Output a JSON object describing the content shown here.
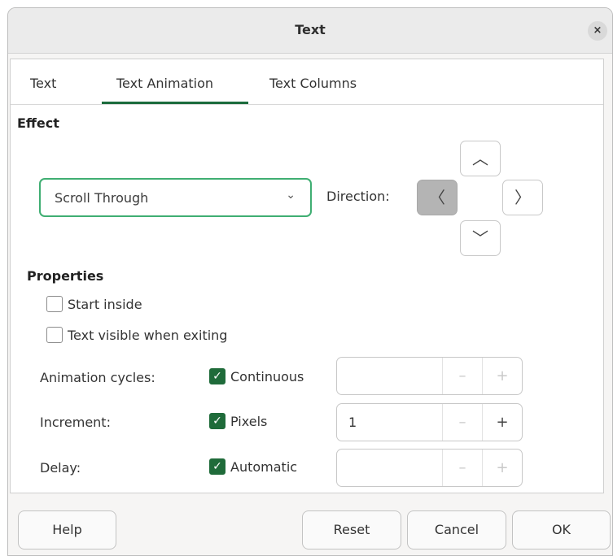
{
  "window": {
    "title": "Text",
    "close_glyph": "×"
  },
  "tabs": [
    {
      "label": "Text"
    },
    {
      "label": "Text Animation",
      "active": true
    },
    {
      "label": "Text Columns"
    }
  ],
  "effect": {
    "heading": "Effect",
    "selected": "Scroll Through",
    "direction_label": "Direction:",
    "selected_direction": "left",
    "arrow_up": "︿",
    "arrow_down": "﹀",
    "arrow_left": "〈",
    "arrow_right": "〉",
    "dropdown_arrow": "⌄"
  },
  "properties": {
    "heading": "Properties",
    "start_inside": {
      "label": "Start inside",
      "checked": false
    },
    "text_visible": {
      "label": "Text visible when exiting",
      "checked": false
    },
    "rows": [
      {
        "label": "Animation cycles:",
        "check_label": "Continuous",
        "checked": true,
        "value": "",
        "enabled": false
      },
      {
        "label": "Increment:",
        "check_label": "Pixels",
        "checked": true,
        "value": "1",
        "enabled": true
      },
      {
        "label": "Delay:",
        "check_label": "Automatic",
        "checked": true,
        "value": "",
        "enabled": false
      }
    ],
    "minus_glyph": "–",
    "plus_glyph": "+",
    "check_glyph": "✓"
  },
  "buttons": {
    "help": "Help",
    "reset": "Reset",
    "cancel": "Cancel",
    "ok": "OK"
  },
  "colors": {
    "accent": "#1f6b3a",
    "focus_border": "#3fae72",
    "selected_direction_bg": "#b4b4b4"
  }
}
